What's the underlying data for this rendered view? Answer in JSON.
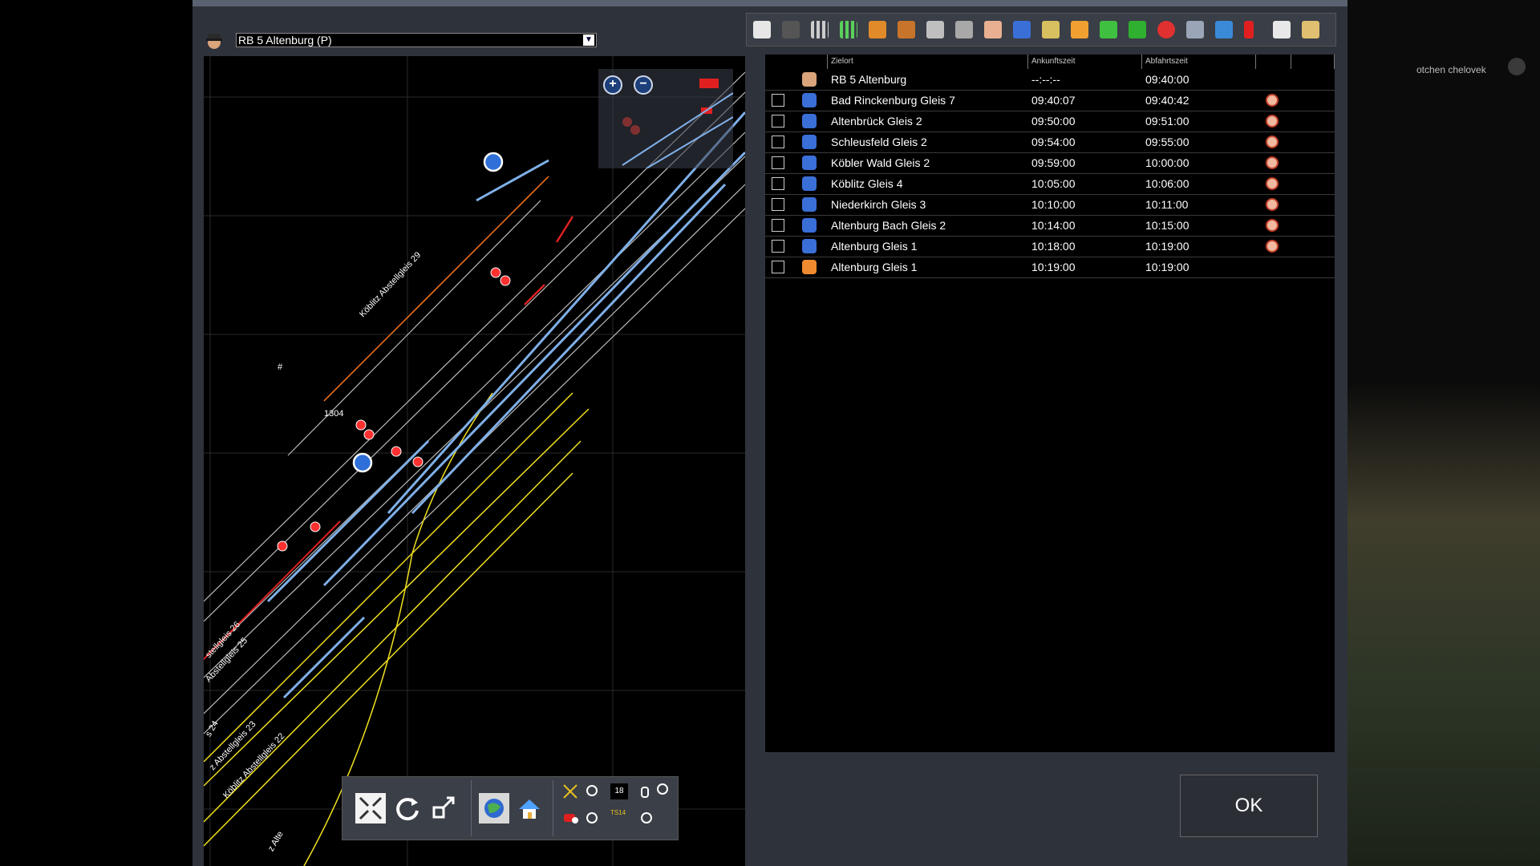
{
  "background": {
    "label": "otchen chelovek"
  },
  "train_selector": {
    "selected": "RB 5 Altenburg (P)"
  },
  "map": {
    "labels": {
      "siding29": "Köblitz Abstellgleis 29",
      "siding26": "stellgleis 26",
      "siding25": "Abstellgleis 25",
      "siding24": "s 24",
      "siding23": "z Abstellgleis 23",
      "siding22": "Köblitz Abstellgleis 22",
      "marker1": "#",
      "marker2": "1304",
      "bottom_label": "z Alte"
    },
    "toolbar": {
      "speed_value": "18",
      "ts_label": "TS14"
    }
  },
  "timetable": {
    "columns": [
      "Zielort",
      "Ankunftszeit",
      "Abfahrtszeit"
    ],
    "rows": [
      {
        "icon": "driver-icon",
        "destination": "RB 5 Altenburg",
        "arrival": "--:--:--",
        "departure": "09:40:00",
        "checkbox": false,
        "clock": false
      },
      {
        "icon": "passengers-icon",
        "destination": "Bad Rinckenburg Gleis 7",
        "arrival": "09:40:07",
        "departure": "09:40:42",
        "checkbox": true,
        "clock": true
      },
      {
        "icon": "passengers-icon",
        "destination": "Altenbrück Gleis 2",
        "arrival": "09:50:00",
        "departure": "09:51:00",
        "checkbox": true,
        "clock": true
      },
      {
        "icon": "passengers-icon",
        "destination": "Schleusfeld Gleis 2",
        "arrival": "09:54:00",
        "departure": "09:55:00",
        "checkbox": true,
        "clock": true
      },
      {
        "icon": "passengers-icon",
        "destination": "Köbler Wald Gleis 2",
        "arrival": "09:59:00",
        "departure": "10:00:00",
        "checkbox": true,
        "clock": true
      },
      {
        "icon": "passengers-icon",
        "destination": "Köblitz Gleis 4",
        "arrival": "10:05:00",
        "departure": "10:06:00",
        "checkbox": true,
        "clock": true
      },
      {
        "icon": "passengers-icon",
        "destination": "Niederkirch Gleis 3",
        "arrival": "10:10:00",
        "departure": "10:11:00",
        "checkbox": true,
        "clock": true
      },
      {
        "icon": "passengers-icon",
        "destination": "Altenburg Bach Gleis 2",
        "arrival": "10:14:00",
        "departure": "10:15:00",
        "checkbox": true,
        "clock": true
      },
      {
        "icon": "passengers-icon",
        "destination": "Altenburg Gleis 1",
        "arrival": "10:18:00",
        "departure": "10:19:00",
        "checkbox": true,
        "clock": true
      },
      {
        "icon": "transfer-icon",
        "destination": "Altenburg Gleis 1",
        "arrival": "10:19:00",
        "departure": "10:19:00",
        "checkbox": true,
        "clock": false
      }
    ]
  },
  "dialog": {
    "ok_label": "OK"
  }
}
